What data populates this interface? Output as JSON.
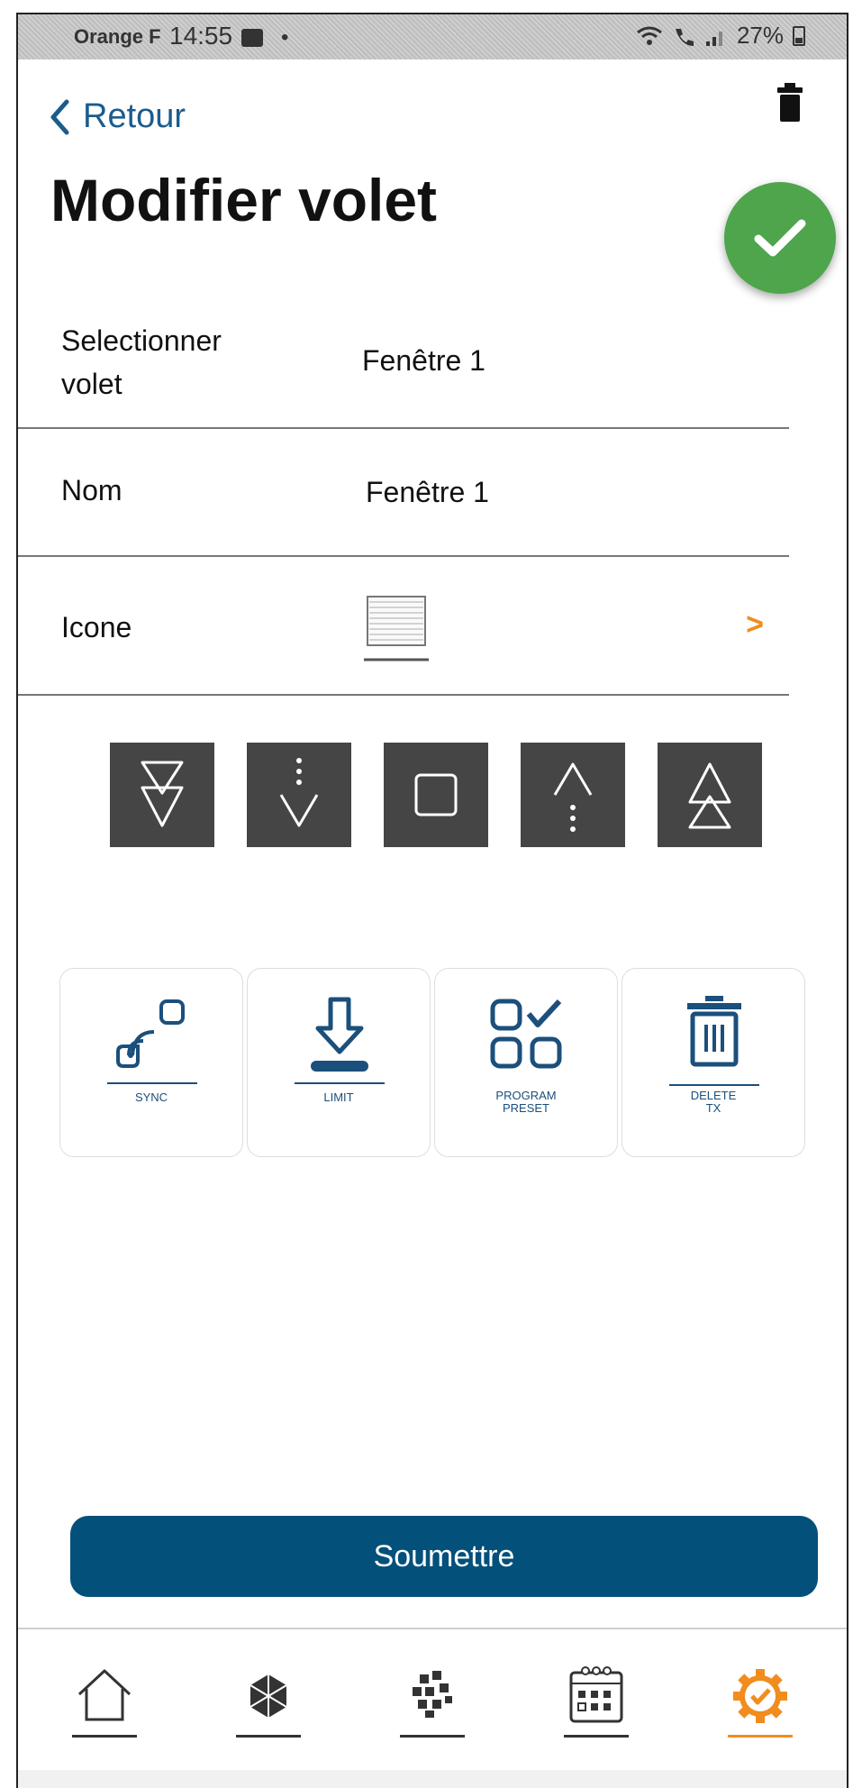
{
  "status_bar": {
    "carrier": "Orange F",
    "time": "14:55",
    "dot": "•",
    "battery": "27%"
  },
  "header": {
    "back_label": "Retour",
    "title": "Modifier volet"
  },
  "form": {
    "select_label": "Selectionner volet",
    "select_value": "Fenêtre 1",
    "name_label": "Nom",
    "name_value": "Fenêtre 1",
    "icon_label": "Icone",
    "chevron": ">"
  },
  "actions": [
    {
      "label": "SYNC"
    },
    {
      "label": "LIMIT"
    },
    {
      "label": "PROGRAM",
      "label2": "PRESET"
    },
    {
      "label": "DELETE",
      "label2": "TX"
    }
  ],
  "submit_label": "Soumettre",
  "colors": {
    "accent": "#03507a",
    "success": "#4ea54c",
    "orange": "#f28c1c",
    "control": "#454545",
    "link": "#1b5c8d"
  },
  "icons": {
    "controls": [
      "double-down-arrow-icon",
      "down-arrow-icon",
      "stop-icon",
      "up-arrow-icon",
      "double-up-arrow-icon"
    ],
    "nav": [
      "home-icon",
      "devices-icon",
      "scenes-icon",
      "calendar-icon",
      "settings-icon"
    ]
  }
}
